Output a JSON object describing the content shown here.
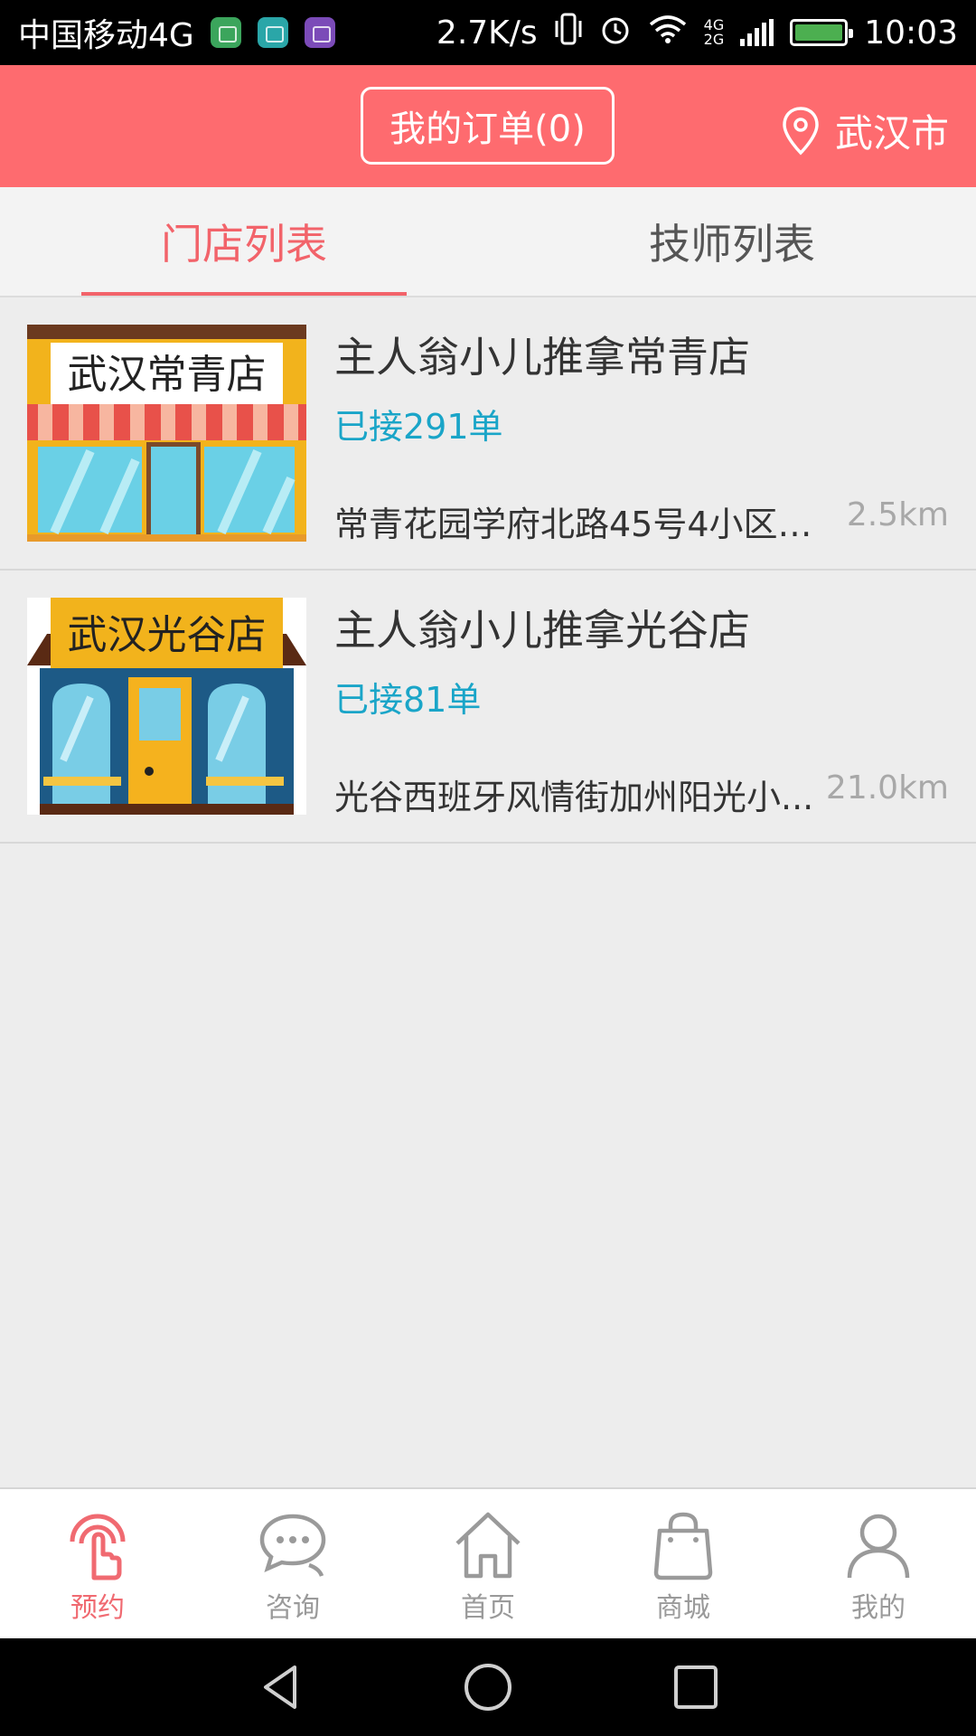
{
  "status_bar": {
    "carrier": "中国移动4G",
    "speed": "2.7K/s",
    "network": "4G 2G",
    "time": "10:03",
    "app_icons": [
      "store-app-icon",
      "android-app-icon",
      "gallery-app-icon"
    ],
    "icons": [
      "vibrate-icon",
      "alarm-icon",
      "wifi-icon",
      "signal-icon",
      "battery-icon"
    ]
  },
  "header": {
    "orders_button": "我的订单(0)",
    "city": "武汉市",
    "background": "#fe6b6f"
  },
  "tabs": [
    {
      "label": "门店列表",
      "active": true
    },
    {
      "label": "技师列表",
      "active": false
    }
  ],
  "stores": [
    {
      "name": "主人翁小儿推拿常青店",
      "orders": "已接291单",
      "address": "常青花园学府北路45号4小区综...",
      "distance": "2.5km",
      "sign": "武汉常青店"
    },
    {
      "name": "主人翁小儿推拿光谷店",
      "orders": "已接81单",
      "address": "光谷西班牙风情街加州阳光小...",
      "distance": "21.0km",
      "sign": "武汉光谷店"
    }
  ],
  "bottom_nav": [
    {
      "label": "预约",
      "icon": "tap-hand-icon",
      "active": true
    },
    {
      "label": "咨询",
      "icon": "chat-bubble-icon",
      "active": false
    },
    {
      "label": "首页",
      "icon": "home-icon",
      "active": false
    },
    {
      "label": "商城",
      "icon": "shopping-bag-icon",
      "active": false
    },
    {
      "label": "我的",
      "icon": "person-icon",
      "active": false
    }
  ],
  "colors": {
    "accent": "#f2636a",
    "orders_text": "#1aa5c8",
    "distance_text": "#a8a8a8"
  }
}
